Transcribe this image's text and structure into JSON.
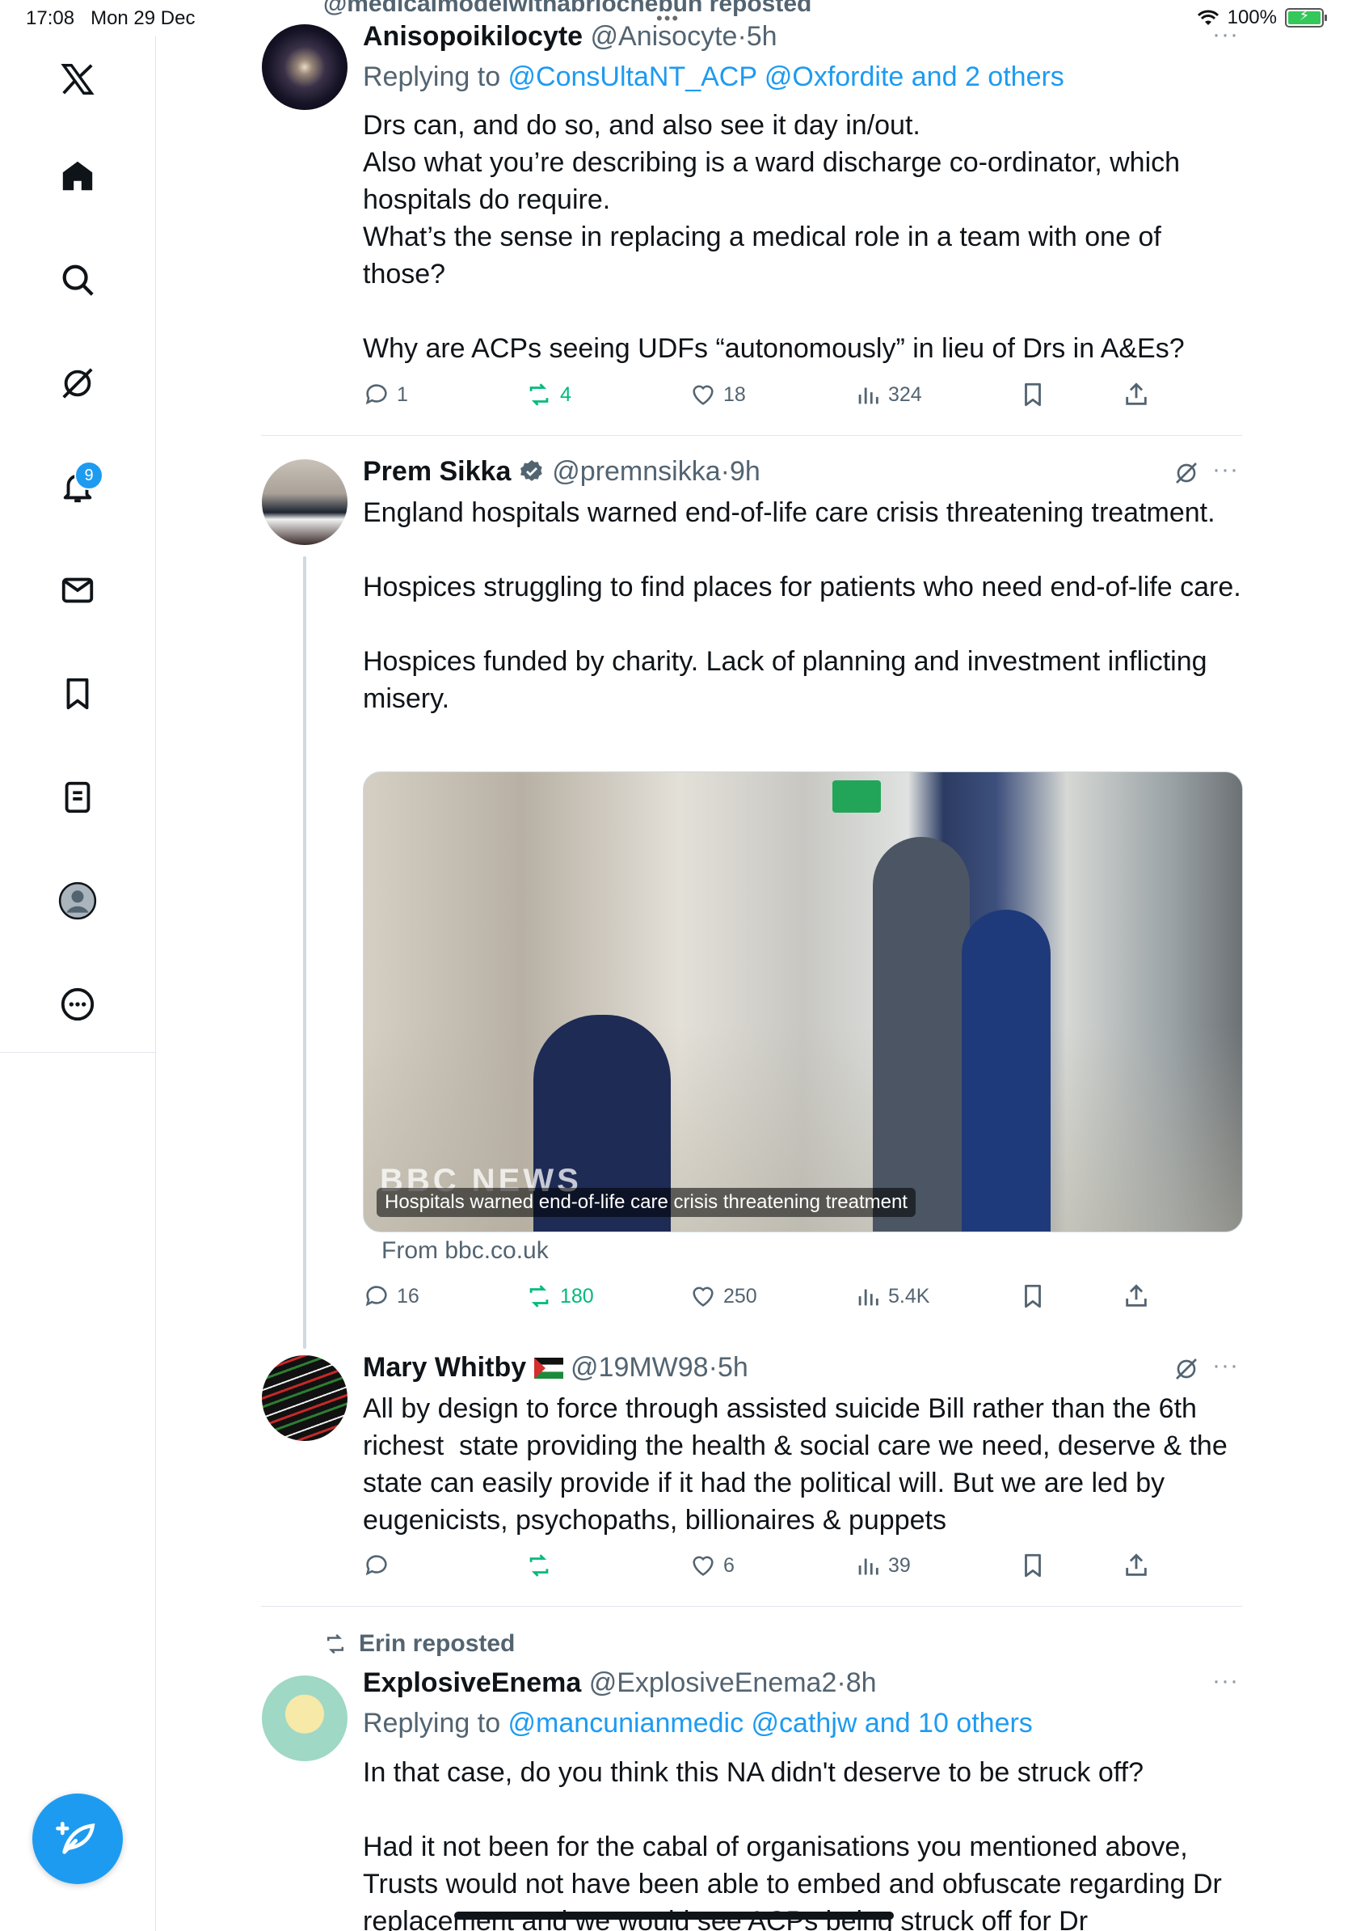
{
  "status_bar": {
    "time": "17:08",
    "date": "Mon 29 Dec",
    "battery": "100%"
  },
  "sidebar": {
    "logo": "x-logo",
    "items": [
      {
        "name": "home",
        "icon": "home-icon"
      },
      {
        "name": "search",
        "icon": "search-icon"
      },
      {
        "name": "grok",
        "icon": "grok-icon"
      },
      {
        "name": "notifications",
        "icon": "bell-icon",
        "badge": "9"
      },
      {
        "name": "messages",
        "icon": "mail-icon"
      },
      {
        "name": "bookmarks",
        "icon": "bookmark-icon"
      },
      {
        "name": "lists",
        "icon": "list-icon"
      },
      {
        "name": "profile",
        "icon": "profile-icon"
      },
      {
        "name": "more",
        "icon": "more-icon"
      }
    ],
    "compose_icon": "compose-icon"
  },
  "top_repost_fragment": "@medicalmodelwithabriochebun reposted",
  "tweets": [
    {
      "name": "Anisopoikilocyte",
      "handle": "@Anisocyte",
      "time": "5h",
      "replying_prefix": "Replying to ",
      "replying_to": "@ConsUltaNT_ACP @Oxfordite and 2 others",
      "text": "Drs can, and do so, and also see it day in/out.\nAlso what you’re describing is a ward discharge co-ordinator, which hospitals do require.\nWhat’s the sense in replacing a medical role in a team with one of those?\n\nWhy are ACPs seeing UDFs “autonomously” in lieu of Drs in A&Es?",
      "replies": "1",
      "reposts": "4",
      "likes": "18",
      "views": "324"
    },
    {
      "name": "Prem Sikka",
      "verified": true,
      "handle": "@premnsikka",
      "time": "9h",
      "text": "England hospitals warned end-of-life care crisis threatening treatment.\n\nHospices struggling to find places for patients who need end-of-life care.\n\nHospices funded by charity. Lack of planning and investment inflicting misery.",
      "card_caption": "Hospitals warned end-of-life care crisis threatening treatment",
      "card_brand": "BBC NEWS",
      "card_source": "From bbc.co.uk",
      "replies": "16",
      "reposts": "180",
      "likes": "250",
      "views": "5.4K"
    },
    {
      "name": "Mary Whitby",
      "flag": "🇵🇸",
      "handle": "@19MW98",
      "time": "5h",
      "text": "All by design to force through assisted suicide Bill rather than the 6th richest  state providing the health & social care we need, deserve & the state can easily provide if it had the political will. But we are led by eugenicists, psychopaths, billionaires & puppets",
      "replies": "",
      "reposts": "",
      "likes": "6",
      "views": "39"
    },
    {
      "repost_label": "Erin reposted",
      "name": "ExplosiveEnema",
      "handle": "@ExplosiveEnema2",
      "time": "8h",
      "replying_prefix": "Replying to ",
      "replying_to": "@mancunianmedic @cathjw and 10 others",
      "text": "In that case, do you think this NA didn't deserve to be struck off?\n\nHad it not been for the cabal of organisations you mentioned above, Trusts would not have been able to embed and obfuscate regarding Dr replacement and we would see ACPs being struck off for Dr"
    }
  ],
  "colors": {
    "accent": "#1d9bf0",
    "repost_green": "#00ba7c",
    "muted": "#536471",
    "border": "#e1e5ea"
  }
}
